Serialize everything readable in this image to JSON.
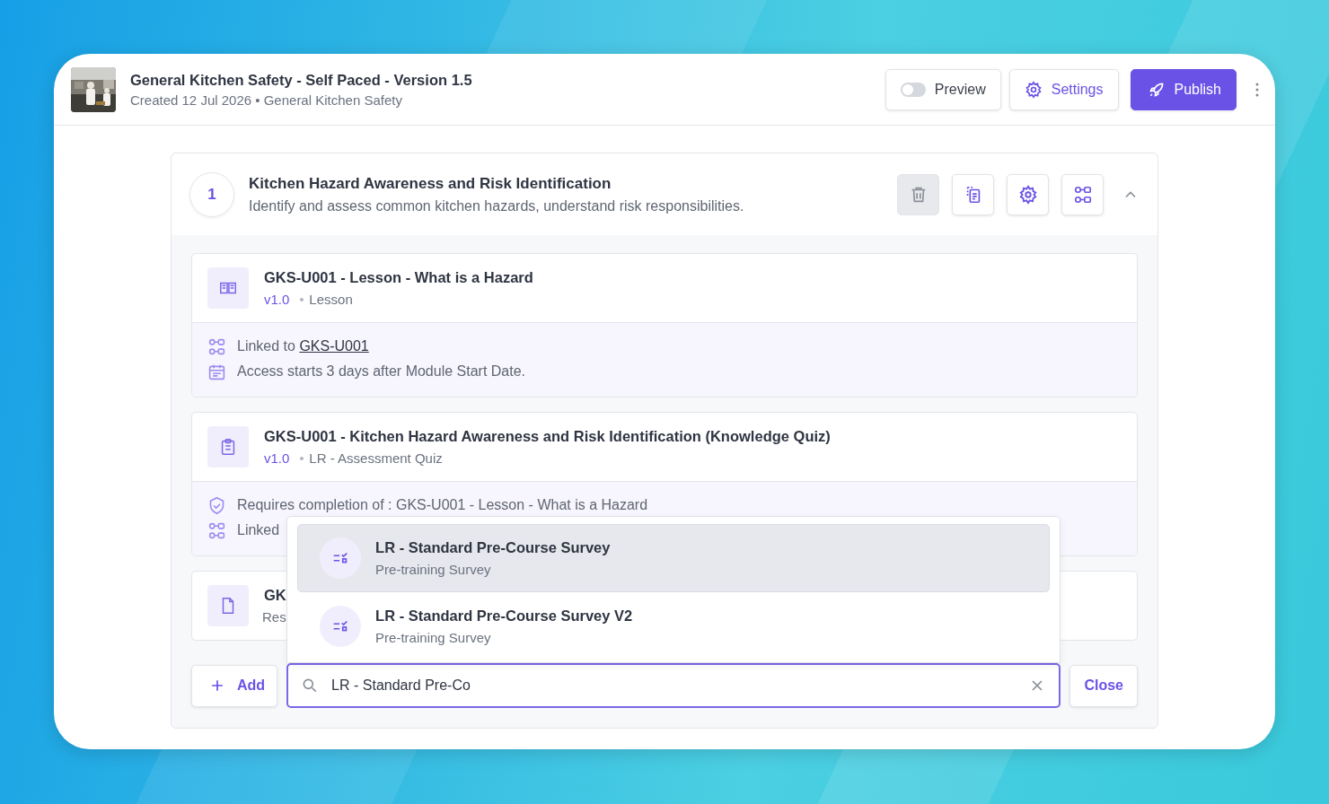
{
  "header": {
    "title": "General Kitchen Safety - Self Paced - Version 1.5",
    "subtitle": "Created 12 Jul 2026 • General Kitchen Safety",
    "preview": {
      "label": "Preview",
      "on": false
    },
    "settings_label": "Settings",
    "publish_label": "Publish"
  },
  "module": {
    "number": "1",
    "title": "Kitchen Hazard Awareness and Risk Identification",
    "description": "Identify and assess common kitchen hazards, understand risk responsibilities.",
    "expanded": true,
    "items": [
      {
        "kind": "lesson",
        "title": "GKS-U001 - Lesson - What is a Hazard",
        "version": "v1.0",
        "type": "Lesson",
        "details": [
          {
            "kind": "linked",
            "text": "Linked to ",
            "link": "GKS-U001"
          },
          {
            "kind": "access",
            "text": "Access starts 3 days after Module Start Date."
          }
        ]
      },
      {
        "kind": "quiz",
        "title": "GKS-U001 - Kitchen Hazard Awareness and Risk Identification (Knowledge Quiz)",
        "version": "v1.0",
        "type": "LR - Assessment Quiz",
        "details": [
          {
            "kind": "requires",
            "text": "Requires completion of : GKS-U001 - Lesson - What is a Hazard"
          },
          {
            "kind": "linked",
            "text": "Linked"
          }
        ]
      },
      {
        "kind": "resource",
        "title": "GK",
        "type": "Res"
      }
    ],
    "add_label": "Add",
    "search": {
      "value": "LR - Standard Pre-Co"
    },
    "close_label": "Close",
    "options": [
      {
        "title": "LR - Standard Pre-Course Survey",
        "subtitle": "Pre-training Survey",
        "selected": true
      },
      {
        "title": "LR - Standard Pre-Course Survey V2",
        "subtitle": "Pre-training Survey",
        "selected": false
      }
    ]
  }
}
